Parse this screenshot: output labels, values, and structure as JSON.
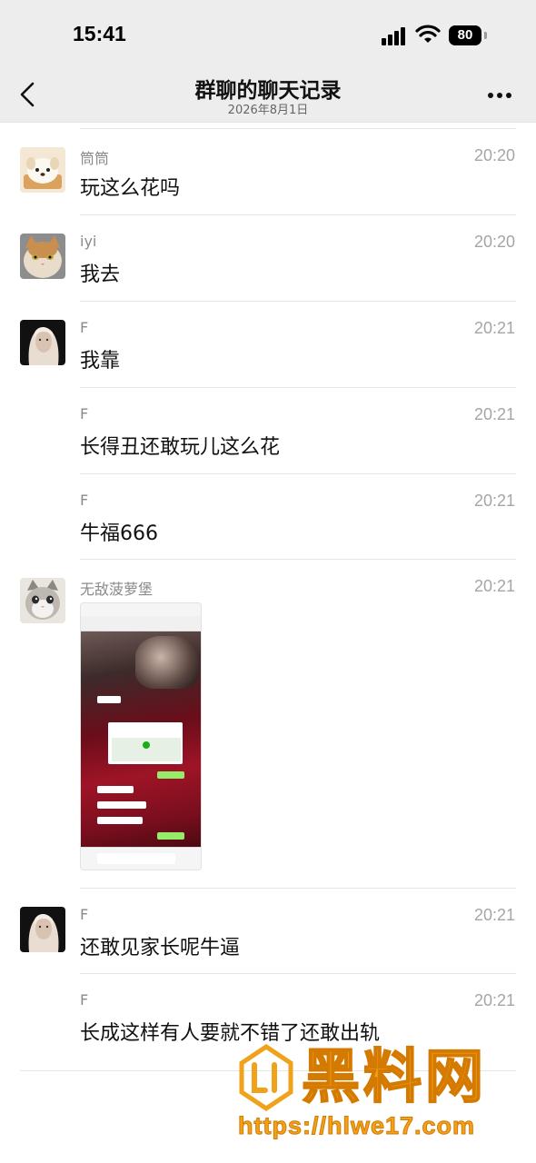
{
  "status_bar": {
    "time": "15:41",
    "battery": "80",
    "battery_level": 0.8
  },
  "nav": {
    "title": "群聊的聊天记录",
    "subtitle": "2026年8月1日",
    "back_icon": "chevron-left-icon",
    "more_icon": "ellipsis-icon"
  },
  "messages": [
    {
      "sender": "筒筒",
      "time": "20:20",
      "text": "玩这么花吗",
      "avatar": "dog-avatar"
    },
    {
      "sender": "iyi",
      "time": "20:20",
      "text": "我去",
      "avatar": "cat-avatar"
    },
    {
      "sender": "F",
      "time": "20:21",
      "text": "我靠",
      "avatar": "woman-avatar"
    },
    {
      "sender": "F",
      "time": "20:21",
      "text": "长得丑还敢玩儿这么花"
    },
    {
      "sender": "F",
      "time": "20:21",
      "text": "牛福666"
    },
    {
      "sender": "无敌菠萝堡",
      "time": "20:21",
      "avatar": "kitten-avatar",
      "image": "chat-screenshot-image"
    },
    {
      "sender": "F",
      "time": "20:21",
      "text": "还敢见家长呢牛逼",
      "avatar": "woman-avatar"
    },
    {
      "sender": "F",
      "time": "20:21",
      "text": "长成这样有人要就不错了还敢出轨"
    }
  ],
  "watermark": {
    "brand": "黑料网",
    "url": "https://hlwe17.com"
  },
  "colors": {
    "nav_background": "#ededed",
    "watermark": "#f0a21a",
    "green_bubble": "#95ec69"
  }
}
